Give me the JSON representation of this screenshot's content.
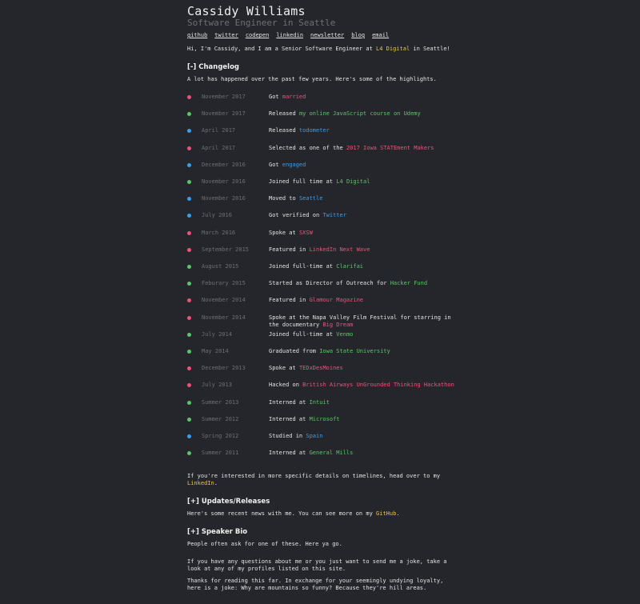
{
  "header": {
    "name": "Cassidy Williams",
    "subtitle": "Software Engineer in Seattle",
    "nav": [
      "github",
      "twitter",
      "codepen",
      "linkedin",
      "newsletter",
      "blog",
      "email"
    ]
  },
  "intro": {
    "before": "Hi, I'm Cassidy, and I am a Senior Software Engineer at ",
    "link": "L4 Digital",
    "after": " in Seattle!"
  },
  "changelog": {
    "heading": "[-] Changelog",
    "lead": "A lot has happened over the past few years. Here's some of the highlights.",
    "items": [
      {
        "date": "November 2017",
        "pre": "Got ",
        "link": "married",
        "post": "",
        "color": "#e8557a"
      },
      {
        "date": "November 2017",
        "pre": "Released ",
        "link": "my online JavaScript course on Udemy",
        "post": "",
        "color": "#5cc567"
      },
      {
        "date": "April 2017",
        "pre": "Released ",
        "link": "todometer",
        "post": "",
        "color": "#3b9de8"
      },
      {
        "date": "April 2017",
        "pre": "Selected as one of the ",
        "link": "2017 Iowa STATEment Makers",
        "post": "",
        "color": "#e8557a"
      },
      {
        "date": "December 2016",
        "pre": "Got ",
        "link": "engaged",
        "post": "",
        "color": "#3b9de8"
      },
      {
        "date": "November 2016",
        "pre": "Joined full time at ",
        "link": "L4 Digital",
        "post": "",
        "color": "#5cc567"
      },
      {
        "date": "November 2016",
        "pre": "Moved to ",
        "link": "Seattle",
        "post": "",
        "color": "#3b9de8"
      },
      {
        "date": "July 2016",
        "pre": "Got verified on ",
        "link": "Twitter",
        "post": "",
        "color": "#3b9de8"
      },
      {
        "date": "March 2016",
        "pre": "Spoke at ",
        "link": "SXSW",
        "post": "",
        "color": "#e8557a"
      },
      {
        "date": "September 2015",
        "pre": "Featured in ",
        "link": "LinkedIn Next Wave",
        "post": "",
        "color": "#e8557a"
      },
      {
        "date": "August 2015",
        "pre": "Joined full-time at ",
        "link": "Clarifai",
        "post": "",
        "color": "#5cc567"
      },
      {
        "date": "Feburary 2015",
        "pre": "Started as Director of Outreach for ",
        "link": "Hacker Fund",
        "post": "",
        "color": "#5cc567"
      },
      {
        "date": "November 2014",
        "pre": "Featured in ",
        "link": "Glamour Magazine",
        "post": "",
        "color": "#e8557a"
      },
      {
        "date": "November 2014",
        "pre": "Spoke at the Napa Valley Film Festival for starring in the documentary ",
        "link": "Big Dream",
        "post": "",
        "color": "#e8557a"
      },
      {
        "date": "July 2014",
        "pre": "Joined full-time at ",
        "link": "Venmo",
        "post": "",
        "color": "#5cc567"
      },
      {
        "date": "May 2014",
        "pre": "Graduated from ",
        "link": "Iowa State University",
        "post": "",
        "color": "#5cc567"
      },
      {
        "date": "December 2013",
        "pre": "Spoke at ",
        "link": "TEDxDesMoines",
        "post": "",
        "color": "#e8557a"
      },
      {
        "date": "July 2013",
        "pre": "Hacked on ",
        "link": "British Airways UnGrounded Thinking Hackathon",
        "post": "",
        "color": "#e8557a"
      },
      {
        "date": "Summer 2013",
        "pre": "Interned at ",
        "link": "Intuit",
        "post": "",
        "color": "#5cc567"
      },
      {
        "date": "Summer 2012",
        "pre": "Interned at ",
        "link": "Microsoft",
        "post": "",
        "color": "#5cc567"
      },
      {
        "date": "Spring 2012",
        "pre": "Studied in ",
        "link": "Spain",
        "post": "",
        "color": "#3b9de8"
      },
      {
        "date": "Summer 2011",
        "pre": "Interned at ",
        "link": "General Mills",
        "post": "",
        "color": "#5cc567"
      }
    ],
    "outro_before": "If you're interested in more specific details on timelines, head over to my ",
    "outro_link": "LinkedIn",
    "outro_after": "."
  },
  "updates": {
    "heading": "[+] Updates/Releases",
    "text_before": "Here's some recent news with me. You can see more on my ",
    "link": "GitHub",
    "text_after": "."
  },
  "bio": {
    "heading": "[+] Speaker Bio",
    "text": "People often ask for one of these. Here ya go."
  },
  "closing": {
    "questions": "If you have any questions about me or you just want to send me a joke, take a look at any of my profiles listed on this site.",
    "joke": "Thanks for reading this far. In exchange for your seemingly undying loyalty, here is a joke: Why are mountains so funny? Because they're hill areas."
  },
  "colors": {
    "background": "#25262b",
    "pink": "#e8557a",
    "green": "#5cc567",
    "blue": "#3b9de8",
    "yellow": "#e9c743"
  }
}
